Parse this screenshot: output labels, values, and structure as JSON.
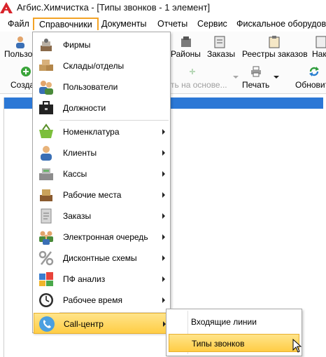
{
  "window": {
    "title": "Агбис.Химчистка - [Типы звонков - 1 элемент]",
    "logo_icon": "agbis-logo-icon"
  },
  "menubar": {
    "items": [
      {
        "label": "Файл"
      },
      {
        "label": "Справочники",
        "active": true
      },
      {
        "label": "Документы"
      },
      {
        "label": "Отчеты"
      },
      {
        "label": "Сервис"
      },
      {
        "label": "Фискальное оборудова"
      }
    ]
  },
  "ribbon": {
    "row1": [
      {
        "label": "Пользо",
        "icon": "users-icon"
      },
      {
        "label": "Районы",
        "icon": "districts-icon"
      },
      {
        "label": "Заказы",
        "icon": "orders-icon"
      },
      {
        "label": "Реестры заказов",
        "icon": "order-registry-icon"
      },
      {
        "label": "Нак",
        "icon": "invoice-icon"
      }
    ],
    "row2": [
      {
        "label": "Созда",
        "icon": "create-plus-icon"
      },
      {
        "label": "ть на основе...",
        "icon": "create-based-on-icon",
        "disabled": true
      },
      {
        "label": "Печать",
        "icon": "printer-icon"
      },
      {
        "label": "Обновит",
        "icon": "refresh-icon"
      }
    ]
  },
  "dropdown": {
    "items": [
      {
        "label": "Фирмы",
        "icon": "firms-icon",
        "submenu": false
      },
      {
        "label": "Склады/отделы",
        "icon": "warehouse-icon",
        "submenu": false
      },
      {
        "label": "Пользователи",
        "icon": "users-icon",
        "submenu": false
      },
      {
        "label": "Должности",
        "icon": "briefcase-icon",
        "submenu": false
      },
      {
        "label": "Номенклатура",
        "icon": "basket-icon",
        "submenu": true
      },
      {
        "label": "Клиенты",
        "icon": "client-icon",
        "submenu": true
      },
      {
        "label": "Кассы",
        "icon": "cash-register-icon",
        "submenu": true
      },
      {
        "label": "Рабочие места",
        "icon": "workplace-icon",
        "submenu": true
      },
      {
        "label": "Заказы",
        "icon": "orders-icon",
        "submenu": true
      },
      {
        "label": "Электронная очередь",
        "icon": "queue-icon",
        "submenu": true
      },
      {
        "label": "Дисконтные схемы",
        "icon": "percent-icon",
        "submenu": true
      },
      {
        "label": "ПФ анализ",
        "icon": "analysis-icon",
        "submenu": true
      },
      {
        "label": "Рабочее время",
        "icon": "clock-icon",
        "submenu": true
      },
      {
        "label": "Call-центр",
        "icon": "phone-icon",
        "submenu": true,
        "highlighted": true
      }
    ]
  },
  "submenu": {
    "items": [
      {
        "label": "Входящие линии"
      },
      {
        "label": "Типы звонков",
        "highlighted": true
      }
    ]
  },
  "colors": {
    "accent": "#f3a326",
    "highlight": "#ffd65a",
    "grid_header": "#2c78d6"
  }
}
